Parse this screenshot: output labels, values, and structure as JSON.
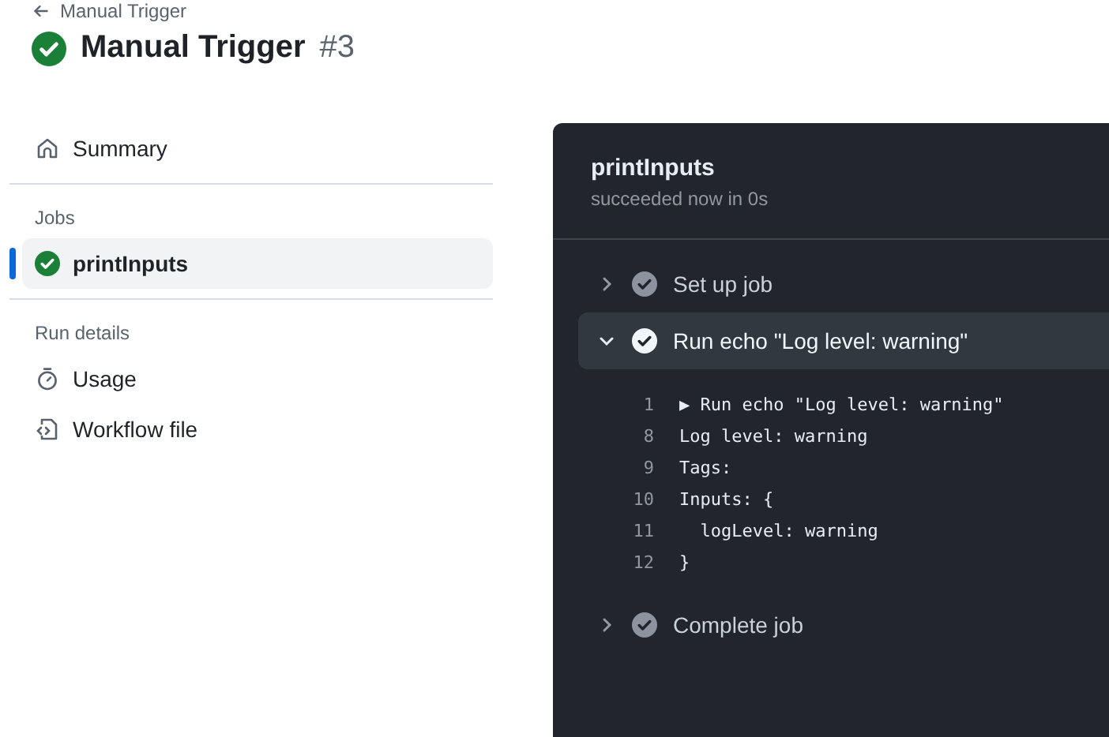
{
  "header": {
    "back_link": "Manual Trigger",
    "title": "Manual Trigger",
    "run_number": "#3"
  },
  "sidebar": {
    "sections": [
      {
        "items": [
          {
            "label": "Summary",
            "selected": false
          }
        ]
      },
      {
        "heading": "Jobs",
        "items": [
          {
            "label": "printInputs",
            "selected": true
          }
        ]
      },
      {
        "heading": "Run details",
        "items": [
          {
            "label": "Usage",
            "selected": false
          },
          {
            "label": "Workflow file",
            "selected": false
          }
        ]
      }
    ]
  },
  "job_panel": {
    "title": "printInputs",
    "subtitle": "succeeded now in 0s",
    "steps": [
      {
        "label": "Set up job",
        "expanded": false
      },
      {
        "label": "Run echo \"Log level: warning\"",
        "expanded": true,
        "log": [
          {
            "number": "1",
            "text": "▶ Run echo \"Log level: warning\""
          },
          {
            "number": "8",
            "text": "Log level: warning"
          },
          {
            "number": "9",
            "text": "Tags:"
          },
          {
            "number": "10",
            "text": "Inputs: {"
          },
          {
            "number": "11",
            "text": "  logLevel: warning"
          },
          {
            "number": "12",
            "text": "}"
          }
        ]
      },
      {
        "label": "Complete job",
        "expanded": false
      }
    ]
  }
}
